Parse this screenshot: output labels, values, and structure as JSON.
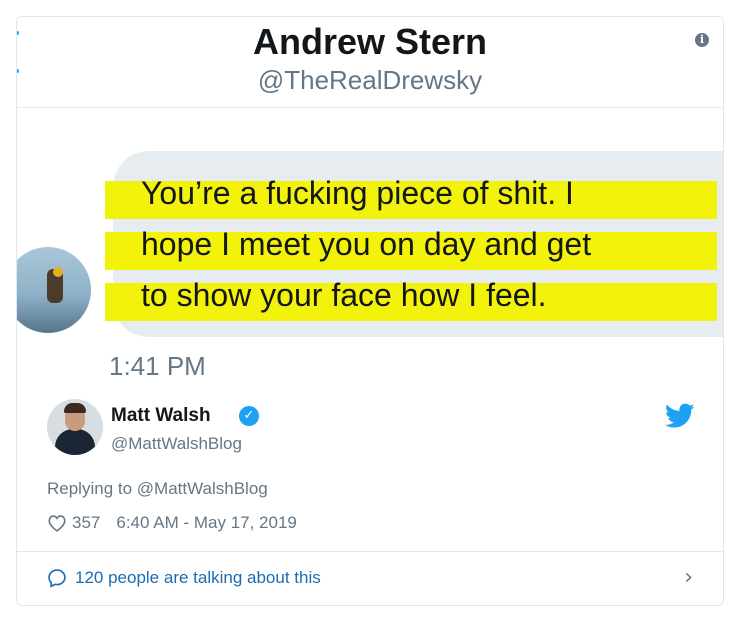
{
  "dm": {
    "name": "Andrew Stern",
    "handle": "@TheRealDrewsky",
    "message_lines": [
      "You’re a fucking piece of shit. I",
      "hope I meet you on day and get",
      "to show your face how I feel."
    ],
    "time": "1:41 PM",
    "highlight_color": "#f2f20a",
    "bubble_color": "#e6ecf0"
  },
  "tweet": {
    "author_name": "Matt Walsh",
    "author_handle": "@MattWalshBlog",
    "verified_icon": "verified-badge-icon",
    "brand_icon": "twitter-bird-icon",
    "replying_prefix": "Replying to",
    "replying_to": "@MattWalshBlog",
    "likes": "357",
    "timestamp": "6:40 AM - May 17, 2019",
    "talking": "120 people are talking about this",
    "accent_color": "#1da1f2"
  }
}
